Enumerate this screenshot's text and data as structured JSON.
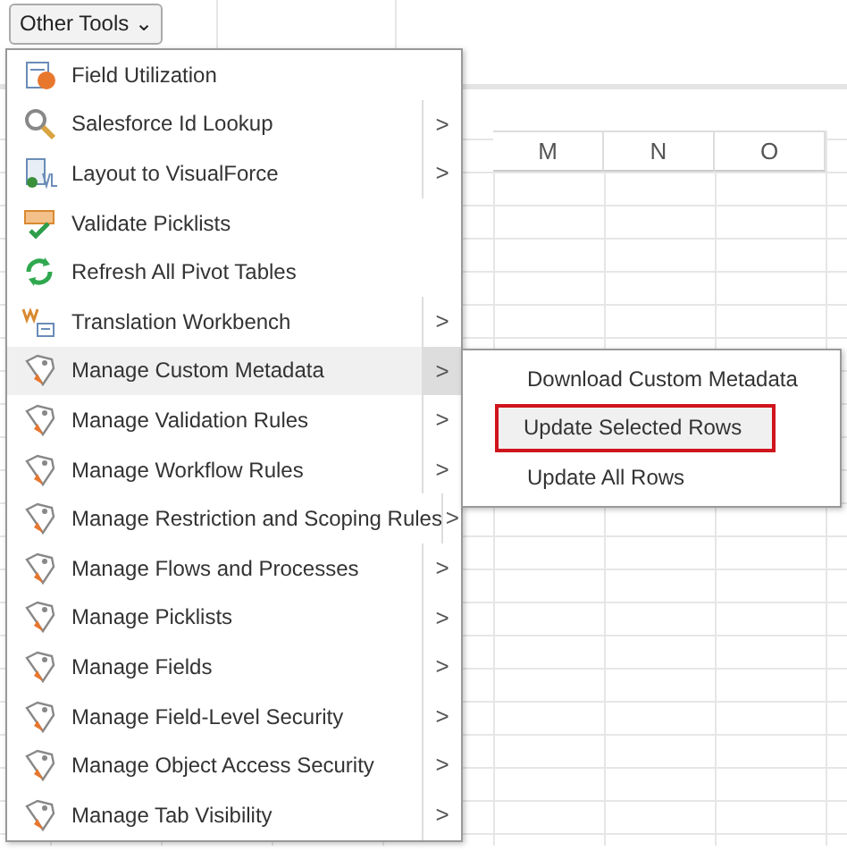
{
  "toolbar": {
    "button": {
      "label": "Other Tools",
      "caret": "⌄"
    }
  },
  "sheet": {
    "columns": [
      "M",
      "N",
      "O"
    ]
  },
  "menu": {
    "items": [
      {
        "label": "Field Utilization",
        "submenu": false,
        "selected": false
      },
      {
        "label": "Salesforce Id Lookup",
        "submenu": true,
        "selected": false
      },
      {
        "label": "Layout to VisualForce",
        "submenu": true,
        "selected": false
      },
      {
        "label": "Validate Picklists",
        "submenu": false,
        "selected": false
      },
      {
        "label": "Refresh All Pivot Tables",
        "submenu": false,
        "selected": false
      },
      {
        "label": "Translation Workbench",
        "submenu": true,
        "selected": false
      },
      {
        "label": "Manage Custom Metadata",
        "submenu": true,
        "selected": true
      },
      {
        "label": "Manage Validation Rules",
        "submenu": true,
        "selected": false
      },
      {
        "label": "Manage Workflow Rules",
        "submenu": true,
        "selected": false
      },
      {
        "label": "Manage Restriction and Scoping Rules",
        "submenu": true,
        "selected": false
      },
      {
        "label": "Manage Flows and Processes",
        "submenu": true,
        "selected": false
      },
      {
        "label": "Manage Picklists",
        "submenu": true,
        "selected": false
      },
      {
        "label": "Manage Fields",
        "submenu": true,
        "selected": false
      },
      {
        "label": "Manage Field-Level Security",
        "submenu": true,
        "selected": false
      },
      {
        "label": "Manage Object Access Security",
        "submenu": true,
        "selected": false
      },
      {
        "label": "Manage Tab Visibility",
        "submenu": true,
        "selected": false
      }
    ],
    "submenu_chevron": ">"
  },
  "submenu": {
    "items": [
      {
        "label": "Download Custom Metadata",
        "selected": false,
        "outlined": false
      },
      {
        "label": "Update Selected Rows",
        "selected": true,
        "outlined": true
      },
      {
        "label": "Update All Rows",
        "selected": false,
        "outlined": false
      }
    ]
  }
}
